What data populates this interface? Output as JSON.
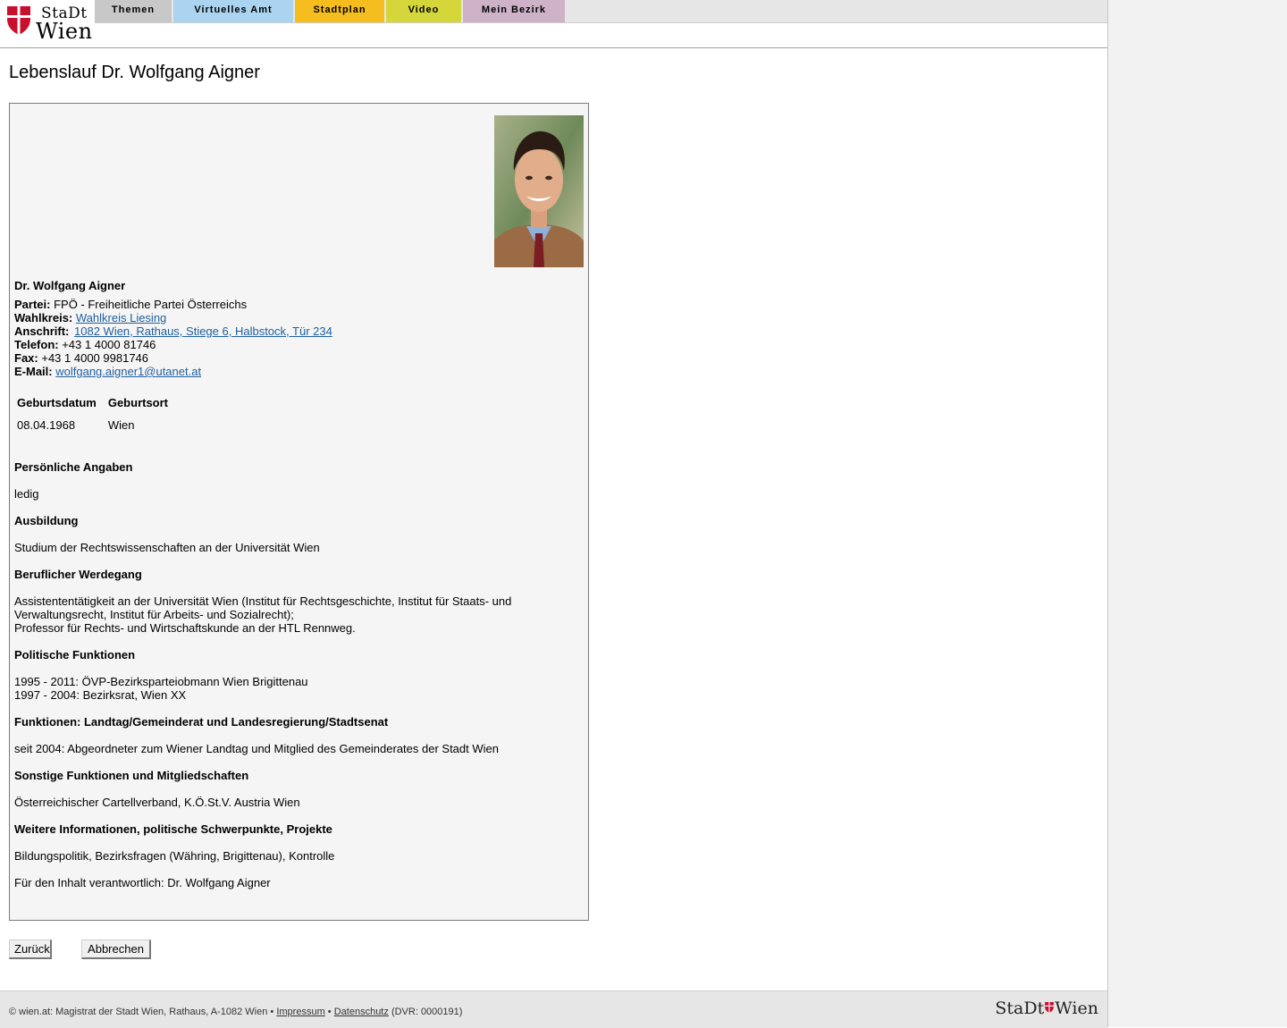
{
  "header": {
    "logo_top": "StaDt",
    "logo_bottom": "Wien",
    "tabs": [
      {
        "label": "Themen",
        "color": "#c8c8c8"
      },
      {
        "label": "Virtuelles Amt",
        "color": "#aad4ef"
      },
      {
        "label": "Stadtplan",
        "color": "#f5be1e"
      },
      {
        "label": "Video",
        "color": "#d4d63a"
      },
      {
        "label": "Mein Bezirk",
        "color": "#cdb2c8"
      }
    ]
  },
  "page_title": "Lebenslauf Dr. Wolfgang Aigner",
  "profile": {
    "name": "Dr. Wolfgang Aigner",
    "partei_label": "Partei:",
    "partei_value": "FPÖ - Freiheitliche Partei Österreichs",
    "wahlkreis_label": "Wahlkreis:",
    "wahlkreis_value": "Wahlkreis Liesing",
    "anschrift_label": "Anschrift:",
    "anschrift_value": "1082 Wien, Rathaus, Stiege 6, Halbstock, Tür 234",
    "telefon_label": "Telefon:",
    "telefon_value": "+43 1 4000 81746",
    "fax_label": "Fax:",
    "fax_value": "+43 1 4000 9981746",
    "email_label": "E-Mail:",
    "email_value": "wolfgang.aigner1@utanet.at"
  },
  "birth_table": {
    "headers": [
      "Geburtsdatum",
      "Geburtsort"
    ],
    "row": [
      "08.04.1968",
      "Wien"
    ]
  },
  "sections": {
    "persoenlich_head": "Persönliche Angaben",
    "persoenlich_text": "ledig",
    "ausbildung_head": "Ausbildung",
    "ausbildung_text": "Studium der Rechtswissenschaften an der Universität Wien",
    "beruf_head": "Beruflicher Werdegang",
    "beruf_line1": "Assistententätigkeit an der Universität Wien (Institut für Rechtsgeschichte, Institut für Staats- und",
    "beruf_line2": "Verwaltungsrecht, Institut für Arbeits- und Sozialrecht);",
    "beruf_line3": "Professor für Rechts- und Wirtschaftskunde an der HTL Rennweg.",
    "politik_head": "Politische Funktionen",
    "politik_line1": "1995 - 2011: ÖVP-Bezirksparteiobmann Wien Brigittenau",
    "politik_line2": "1997 - 2004: Bezirksrat, Wien XX",
    "landtag_head": "Funktionen: Landtag/Gemeinderat und Landesregierung/Stadtsenat",
    "landtag_text": "seit 2004: Abgeordneter zum Wiener Landtag und Mitglied des Gemeinderates der Stadt Wien",
    "sonstige_head": "Sonstige Funktionen und Mitgliedschaften",
    "sonstige_text": "Österreichischer Cartellverband, K.Ö.St.V. Austria Wien",
    "weitere_head": "Weitere Informationen, politische Schwerpunkte, Projekte",
    "weitere_text": "Bildungspolitik, Bezirksfragen (Währing, Brigittenau), Kontrolle",
    "verantwortlich": "Für den Inhalt verantwortlich: Dr. Wolfgang Aigner"
  },
  "buttons": {
    "back": "Zurück",
    "cancel": "Abbrechen"
  },
  "footer": {
    "copyright": "© wien.at: Magistrat der Stadt Wien, Rathaus, A-1082 Wien •",
    "impressum": "Impressum",
    "separator": "•",
    "datenschutz": "Datenschutz",
    "dvr": "(DVR: 0000191)",
    "logo_left": "StaDt",
    "logo_right": "Wien"
  }
}
